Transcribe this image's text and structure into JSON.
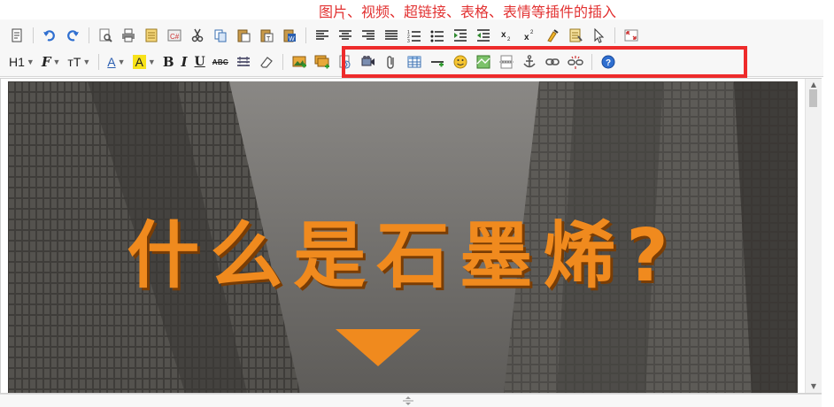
{
  "annotation": {
    "text": "图片、视频、超链接、表格、表情等插件的插入",
    "color": "#e23232"
  },
  "toolbar": {
    "row1": [
      {
        "name": "source-code-icon",
        "kind": "icon"
      },
      {
        "kind": "sep"
      },
      {
        "name": "undo-icon",
        "kind": "icon"
      },
      {
        "name": "redo-icon",
        "kind": "icon"
      },
      {
        "kind": "sep"
      },
      {
        "name": "preview-icon",
        "kind": "icon"
      },
      {
        "name": "print-icon",
        "kind": "icon"
      },
      {
        "name": "template-icon",
        "kind": "icon"
      },
      {
        "name": "code-snippet-icon",
        "kind": "icon"
      },
      {
        "name": "cut-icon",
        "kind": "icon"
      },
      {
        "name": "copy-icon",
        "kind": "icon"
      },
      {
        "name": "paste-icon",
        "kind": "icon"
      },
      {
        "name": "paste-text-icon",
        "kind": "icon"
      },
      {
        "name": "paste-word-icon",
        "kind": "icon"
      },
      {
        "kind": "sep"
      },
      {
        "name": "align-left-icon",
        "kind": "icon"
      },
      {
        "name": "align-center-icon",
        "kind": "icon"
      },
      {
        "name": "align-right-icon",
        "kind": "icon"
      },
      {
        "name": "align-justify-icon",
        "kind": "icon"
      },
      {
        "name": "ordered-list-icon",
        "kind": "icon"
      },
      {
        "name": "unordered-list-icon",
        "kind": "icon"
      },
      {
        "name": "indent-icon",
        "kind": "icon"
      },
      {
        "name": "outdent-icon",
        "kind": "icon"
      },
      {
        "name": "subscript-icon",
        "kind": "icon"
      },
      {
        "name": "superscript-icon",
        "kind": "icon"
      },
      {
        "name": "clear-format-icon",
        "kind": "icon"
      },
      {
        "name": "select-all-icon",
        "kind": "icon"
      },
      {
        "name": "select-cursor-icon",
        "kind": "icon"
      },
      {
        "kind": "sep"
      },
      {
        "name": "fullscreen-icon",
        "kind": "icon"
      }
    ],
    "row2_text": {
      "heading": "H1",
      "font_family": "F",
      "font_size": "тT",
      "fore_color": "A",
      "hilite_color": "A",
      "bold": "B",
      "italic": "I",
      "underline": "U",
      "strikethrough": "ABC"
    },
    "row2_icons": [
      "insert-image-icon",
      "multi-image-icon",
      "flash-icon",
      "media-video-icon",
      "attachment-icon",
      "table-icon",
      "horizontal-rule-icon",
      "emoticon-icon",
      "baidu-map-icon",
      "page-break-icon",
      "anchor-icon",
      "link-icon",
      "unlink-icon",
      "about-icon"
    ]
  },
  "editor": {
    "hero_title": "什么是石墨烯?",
    "accent": "#f08a1e",
    "highlight_box_color": "#ee2b2b"
  }
}
